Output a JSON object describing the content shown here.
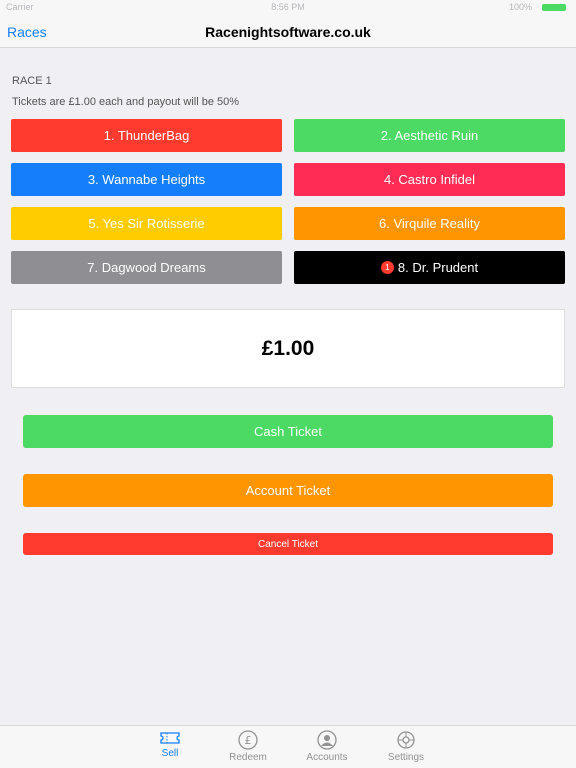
{
  "status": {
    "carrier": "Carrier",
    "time": "8:56 PM",
    "battery": "100%"
  },
  "nav": {
    "back_label": "Races",
    "title": "Racenightsoftware.co.uk"
  },
  "race": {
    "header": "RACE 1",
    "info": "Tickets are £1.00 each and payout will be 50%"
  },
  "horses": [
    {
      "label": "1. ThunderBag",
      "color": "#ff3b30"
    },
    {
      "label": "2. Aesthetic Ruin",
      "color": "#4cd964"
    },
    {
      "label": "3. Wannabe Heights",
      "color": "#147efb"
    },
    {
      "label": "4. Castro Infidel",
      "color": "#ff2d55"
    },
    {
      "label": "5. Yes Sir Rotisserie",
      "color": "#ffcc00"
    },
    {
      "label": "6. Virquile Reality",
      "color": "#ff9500"
    },
    {
      "label": "7. Dagwood Dreams",
      "color": "#8e8e93"
    },
    {
      "label": "8. Dr. Prudent",
      "color": "#000000",
      "badge": "1"
    }
  ],
  "price": "£1.00",
  "actions": {
    "cash": "Cash Ticket",
    "account": "Account Ticket",
    "cancel": "Cancel Ticket"
  },
  "tabs": [
    {
      "label": "Sell",
      "icon": "ticket-icon",
      "active": true
    },
    {
      "label": "Redeem",
      "icon": "pound-coin-icon",
      "active": false
    },
    {
      "label": "Accounts",
      "icon": "accounts-icon",
      "active": false
    },
    {
      "label": "Settings",
      "icon": "gear-icon",
      "active": false
    }
  ]
}
